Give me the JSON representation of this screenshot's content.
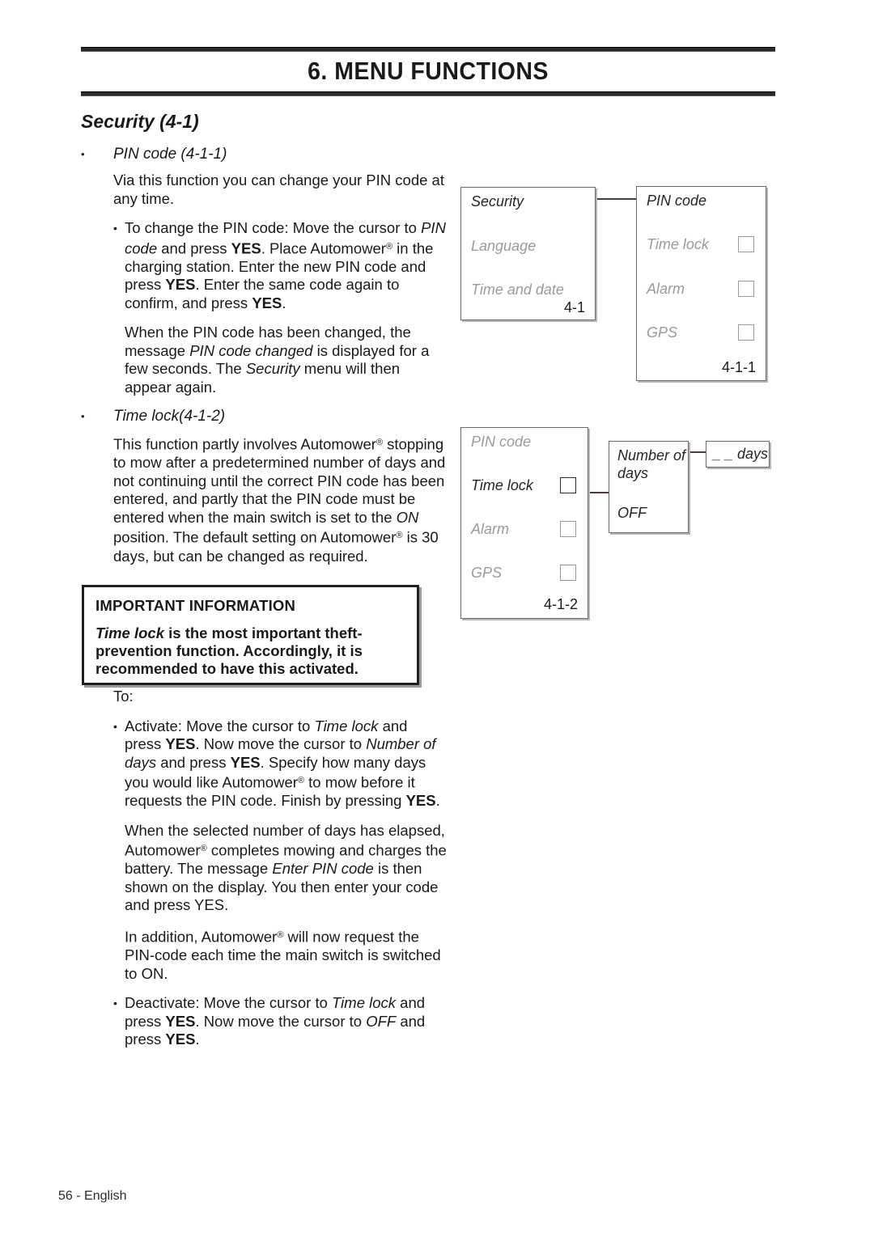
{
  "header": {
    "chapter_title": "6. MENU FUNCTIONS"
  },
  "section": {
    "heading": "Security (4-1)",
    "bullet_glyph": "•"
  },
  "topics": [
    {
      "title": "PIN code (4-1-1)",
      "intro": "Via this function you can change your PIN code at any time.",
      "item1_prefix": "To change the PIN code: Move the cursor to ",
      "item1_em1": "PIN code",
      "item1_mid1": " and press ",
      "item1_strong1": "YES",
      "item1_mid2": ". Place Automower",
      "item1_reg": "®",
      "item1_mid3": " in the charging station. Enter the new PIN code and press ",
      "item1_strong2": "YES",
      "item1_mid4": ". Enter the same code again to confirm, and press ",
      "item1_strong3": "YES",
      "item1_end": ".",
      "item1_note_pre": "When the PIN code has been changed, the message ",
      "item1_note_em1": "PIN code changed",
      "item1_note_mid": " is displayed for a few seconds. The ",
      "item1_note_em2": "Security",
      "item1_note_end": " menu will then appear again."
    },
    {
      "title": "Time lock(4-1-2)",
      "body_pre": "This function partly involves Automower",
      "body_reg": "®",
      "body_mid1": " stopping to mow after a predetermined number of days and not continuing until the correct PIN code has been entered, and partly that the PIN code must be entered when the main switch is set to the ",
      "body_em1": "ON",
      "body_mid2": " position. The default setting on Automower",
      "body_reg2": "®",
      "body_end": " is 30 days, but can be changed as required."
    }
  ],
  "important_box": {
    "title": "IMPORTANT INFORMATION",
    "em": "Time lock",
    "rest": " is the most important theft-prevention function. Accordingly, it is recommended to have this activated."
  },
  "instructions": {
    "lead": "To:",
    "activate_pre": "Activate: Move the cursor to ",
    "activate_em1": "Time lock",
    "activate_mid1": " and press ",
    "activate_strong1": "YES",
    "activate_mid2": ". Now move the cursor to ",
    "activate_em2": "Number of days",
    "activate_mid3": " and press ",
    "activate_strong2": "YES",
    "activate_mid4": ". Specify how many days you would like Automower",
    "activate_reg": "®",
    "activate_mid5": " to mow before it requests the PIN code. Finish by pressing ",
    "activate_strong3": "YES",
    "activate_end": ".",
    "elapsed_pre": "When the selected number of days has elapsed, Automower",
    "elapsed_reg": "®",
    "elapsed_mid1": " completes mowing and charges the battery. The message ",
    "elapsed_em1": "Enter PIN code",
    "elapsed_end": " is then shown on the display. You then enter your code and press YES.",
    "addition_pre": "In addition, Automower",
    "addition_reg": "®",
    "addition_end": " will now request the PIN-code each time the main switch is switched to ON.",
    "deactivate_pre": "Deactivate: Move the cursor to ",
    "deactivate_em1": "Time lock",
    "deactivate_mid1": " and press ",
    "deactivate_strong1": "YES",
    "deactivate_mid2": ". Now move the cursor to ",
    "deactivate_em2": "OFF",
    "deactivate_mid3": " and press ",
    "deactivate_strong2": "YES",
    "deactivate_end": "."
  },
  "diagram1": {
    "security_box": {
      "title": "Security",
      "rows": [
        "Language",
        "Time and date"
      ],
      "code": "4-1"
    },
    "pin_box": {
      "title": "PIN code",
      "rows": [
        "Time lock",
        "Alarm",
        "GPS"
      ],
      "code": "4-1-1"
    }
  },
  "diagram2": {
    "pin_box": {
      "title": "PIN code",
      "rows": [
        "Time lock",
        "Alarm",
        "GPS"
      ],
      "code": "4-1-2"
    },
    "days_box": {
      "line1": "Number of",
      "line2": "days",
      "line3": "OFF"
    },
    "value_box": {
      "label": "_ _ days"
    }
  },
  "footer": {
    "text": "56 - English"
  }
}
